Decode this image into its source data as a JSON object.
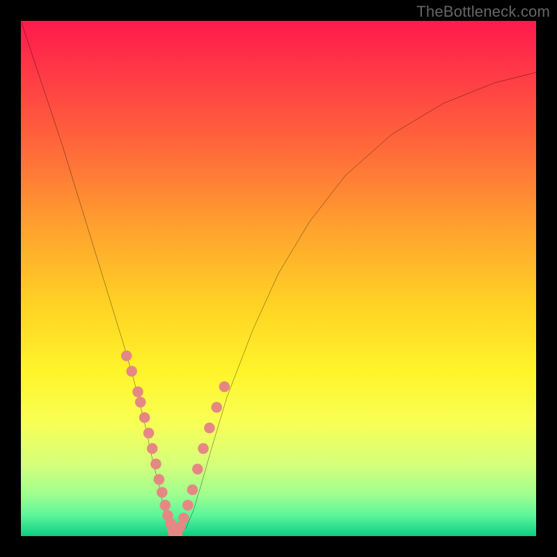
{
  "watermark": "TheBottleneck.com",
  "chart_data": {
    "type": "line",
    "title": "",
    "xlabel": "",
    "ylabel": "",
    "xlim": [
      0,
      100
    ],
    "ylim": [
      0,
      100
    ],
    "series": [
      {
        "name": "bottleneck-curve",
        "x": [
          0,
          4,
          8,
          12,
          16,
          20,
          22,
          24,
          25.5,
          27,
          28,
          29,
          29.7,
          30.5,
          32,
          33.5,
          35,
          37,
          40,
          45,
          50,
          56,
          63,
          72,
          82,
          92,
          100
        ],
        "y": [
          100,
          88,
          76,
          63,
          50,
          37,
          30,
          22,
          15,
          9,
          4,
          1.5,
          0.3,
          0.3,
          1.5,
          5,
          10,
          17,
          27,
          40,
          51,
          61,
          70,
          78,
          84,
          88,
          90
        ]
      },
      {
        "name": "left-dots",
        "type": "scatter",
        "color": "#e58884",
        "x": [
          20.5,
          21.5,
          22.7,
          23.2,
          24.0,
          24.8,
          25.5,
          26.2,
          26.8,
          27.4,
          28.0,
          28.5,
          29.0,
          29.4
        ],
        "y": [
          35,
          32,
          28,
          26,
          23,
          20,
          17,
          14,
          11,
          8.5,
          6,
          4,
          2.5,
          1.2
        ]
      },
      {
        "name": "right-dots",
        "type": "scatter",
        "color": "#e58884",
        "x": [
          30.3,
          30.9,
          31.6,
          32.4,
          33.3,
          34.3,
          35.4,
          36.6,
          38.0,
          39.5
        ],
        "y": [
          0.8,
          1.8,
          3.5,
          6,
          9,
          13,
          17,
          21,
          25,
          29
        ]
      },
      {
        "name": "trough-dots",
        "type": "scatter",
        "color": "#e58884",
        "x": [
          29.7,
          30.0,
          30.3
        ],
        "y": [
          0.3,
          0.25,
          0.3
        ]
      }
    ]
  }
}
